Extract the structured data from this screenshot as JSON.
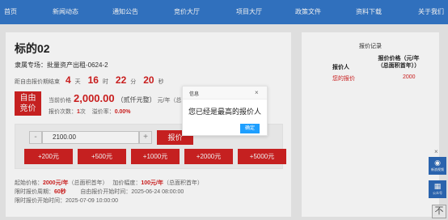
{
  "nav": [
    "首页",
    "新闻动态",
    "通知公告",
    "竞价大厅",
    "项目大厅",
    "政策文件",
    "资料下载",
    "关于我们"
  ],
  "lot": {
    "title": "标的02",
    "project_label": "隶属专场：",
    "project_name": "批量资产出租-0624-2",
    "countdown_label": "距自由报价期结束",
    "days": "4",
    "days_unit": "天",
    "hours": "16",
    "hours_unit": "时",
    "minutes": "22",
    "minutes_unit": "分",
    "seconds": "20",
    "seconds_unit": "秒"
  },
  "badge": {
    "line1": "自由",
    "line2": "竞价"
  },
  "current": {
    "label": "当前价格",
    "price": "2,000.00",
    "price_cn": "（贰仟元整）",
    "unit": "元/年（总面积首年）"
  },
  "stats": {
    "bids_label": "报价次数：",
    "bids": "1",
    "bids_unit": "次",
    "premium_label": "溢价率：",
    "premium": "0.00%"
  },
  "bid": {
    "minus": "-",
    "value": "2100.00",
    "plus": "+",
    "button": "报价",
    "increments": [
      "+200元",
      "+500元",
      "+1000元",
      "+2000元",
      "+5000元"
    ]
  },
  "info": {
    "start_label": "起始价格：",
    "start_value": "2000元/年",
    "start_note": "（总面积首年）",
    "step_label": "加价幅度：",
    "step_value": "100元/年",
    "step_note": "（总面积首年）",
    "period_label": "限时报价周期：",
    "period_value": "60秒",
    "free_start_label": "自由报价开始时间：",
    "free_start_value": "2025-06-24 08:00:00",
    "limit_start_label": "限时报价开始时间：",
    "limit_start_value": "2025-07-09 10:00:00"
  },
  "records": {
    "title": "报价记录",
    "col_bidder": "报价人",
    "col_price_1": "报价价格（元/年",
    "col_price_2": "（总面积首年））",
    "row_bidder": "您的报价",
    "row_price": "2000"
  },
  "dialog": {
    "title": "信息",
    "close": "×",
    "message": "您已经是最高的报价人",
    "ok": "确定"
  },
  "floating": {
    "close": "×",
    "items": [
      {
        "icon": "eye-icon",
        "label": "新浪视频"
      },
      {
        "icon": "qrcode-icon",
        "label": "公众号"
      }
    ],
    "top_label": "不"
  },
  "colors": {
    "nav": "#3477c9",
    "accent": "#d22323",
    "dialog_button": "#1e9fff"
  }
}
